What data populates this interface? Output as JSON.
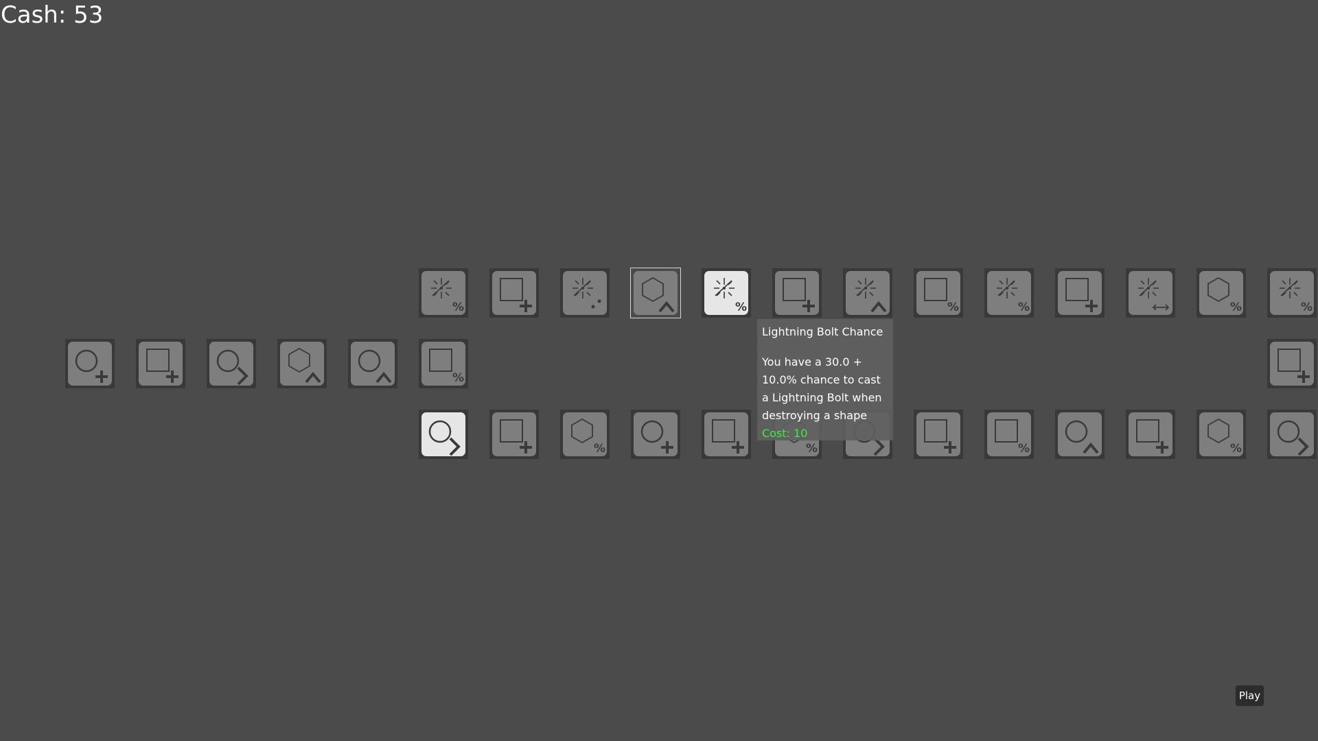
{
  "cash": {
    "label": "Cash: 53"
  },
  "tooltip": {
    "title": "Lightning Bolt Chance",
    "description": "You have a 30.0 + 10.0% chance to cast a Lightning Bolt when destroying a shape",
    "cost": "Cost: 10"
  },
  "play_button": {
    "label": "Play"
  },
  "colors": {
    "background": "#4b4b4b",
    "node_locked": "#7e7e7e",
    "node_bought": "#e6e6e6",
    "cost_text": "#3cf03c"
  },
  "skill_tree": {
    "top_row": [
      {
        "icon": "lightning-percent-icon",
        "state": "locked"
      },
      {
        "icon": "square-plus-icon",
        "state": "locked"
      },
      {
        "icon": "lightning-chain-icon",
        "state": "locked"
      },
      {
        "icon": "hexagon-upgrade-icon",
        "state": "selected"
      },
      {
        "icon": "lightning-percent-icon",
        "state": "bought"
      },
      {
        "icon": "square-plus-icon",
        "state": "locked"
      },
      {
        "icon": "lightning-upgrade-icon",
        "state": "locked"
      },
      {
        "icon": "square-percent-icon",
        "state": "locked"
      },
      {
        "icon": "lightning-percent-icon",
        "state": "locked"
      },
      {
        "icon": "square-plus-icon",
        "state": "locked"
      },
      {
        "icon": "lightning-range-icon",
        "state": "locked"
      },
      {
        "icon": "hexagon-percent-icon",
        "state": "locked"
      },
      {
        "icon": "lightning-percent-icon",
        "state": "locked"
      }
    ],
    "middle_row": [
      {
        "icon": "circle-plus-icon",
        "state": "locked"
      },
      {
        "icon": "square-plus-icon",
        "state": "locked"
      },
      {
        "icon": "circle-right-icon",
        "state": "locked"
      },
      {
        "icon": "hexagon-upgrade-icon",
        "state": "locked"
      },
      {
        "icon": "circle-upgrade-icon",
        "state": "locked"
      },
      {
        "icon": "square-percent-icon",
        "state": "locked"
      },
      {
        "icon": "square-plus-icon",
        "state": "locked"
      }
    ],
    "bottom_row": [
      {
        "icon": "circle-right-icon",
        "state": "bought"
      },
      {
        "icon": "square-plus-icon",
        "state": "locked"
      },
      {
        "icon": "hexagon-percent-icon",
        "state": "locked"
      },
      {
        "icon": "circle-plus-icon",
        "state": "locked"
      },
      {
        "icon": "square-plus-icon",
        "state": "locked"
      },
      {
        "icon": "hexagon-percent-icon",
        "state": "locked"
      },
      {
        "icon": "circle-right-icon",
        "state": "locked"
      },
      {
        "icon": "square-plus-icon",
        "state": "locked"
      },
      {
        "icon": "square-percent-icon",
        "state": "locked"
      },
      {
        "icon": "circle-upgrade-icon",
        "state": "locked"
      },
      {
        "icon": "square-plus-icon",
        "state": "locked"
      },
      {
        "icon": "hexagon-percent-icon",
        "state": "locked"
      },
      {
        "icon": "circle-right-icon",
        "state": "locked"
      }
    ]
  }
}
